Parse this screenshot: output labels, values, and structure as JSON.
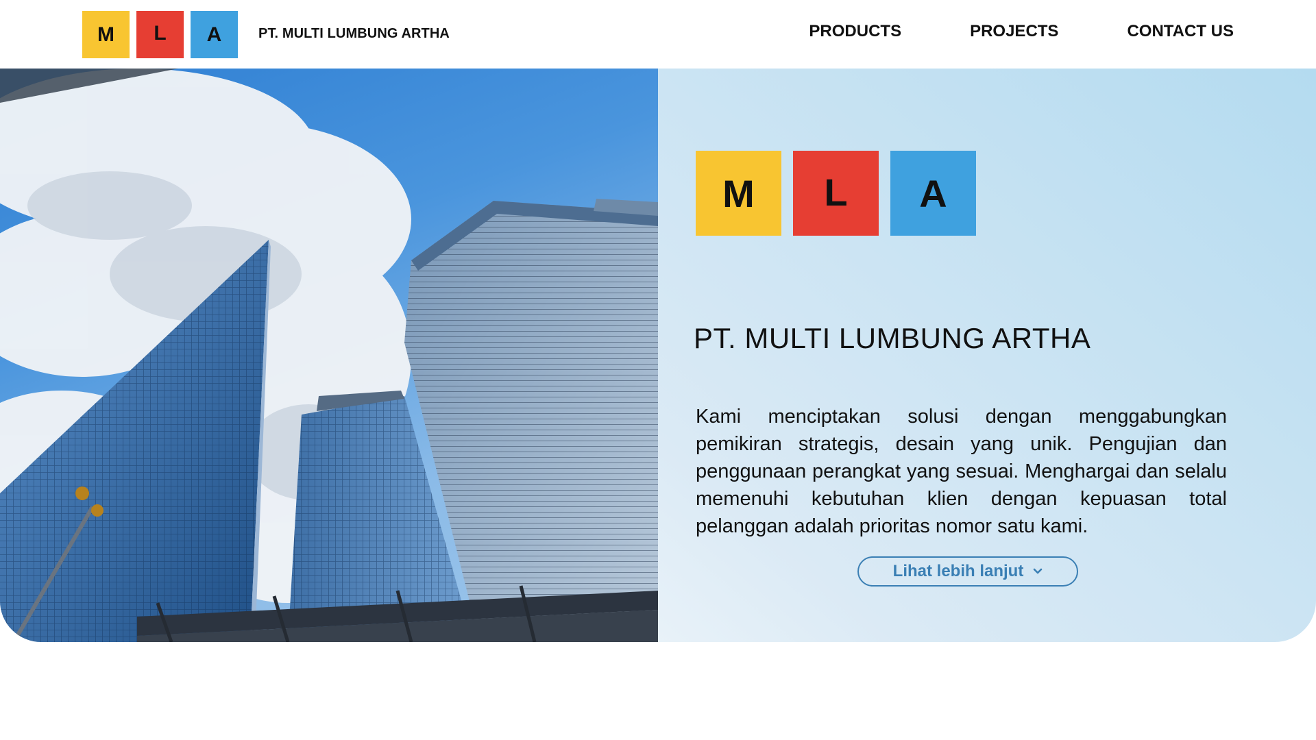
{
  "brand": {
    "letters": [
      "M",
      "L",
      "A"
    ],
    "tile_colors": [
      "#F8C531",
      "#E63E33",
      "#3FA1DF"
    ],
    "company_name": "PT. MULTI LUMBUNG ARTHA"
  },
  "nav": {
    "items": [
      {
        "label": "PRODUCTS"
      },
      {
        "label": "PROJECTS"
      },
      {
        "label": "CONTACT US"
      }
    ]
  },
  "hero": {
    "image": "skyscrapers-against-cloudy-sky-photo",
    "title": "PT. MULTI LUMBUNG ARTHA",
    "description": "Kami menciptakan solusi dengan menggabungkan pemikiran strategis, desain yang unik. Pengujian dan penggunaan perangkat yang sesuai. Menghargai dan selalu memenuhi kebutuhan klien dengan kepuasan total pelanggan adalah prioritas nomor satu kami.",
    "cta_label": "Lihat lebih lanjut",
    "cta_icon": "chevron-down-icon",
    "accent_color": "#3a7fb4"
  }
}
